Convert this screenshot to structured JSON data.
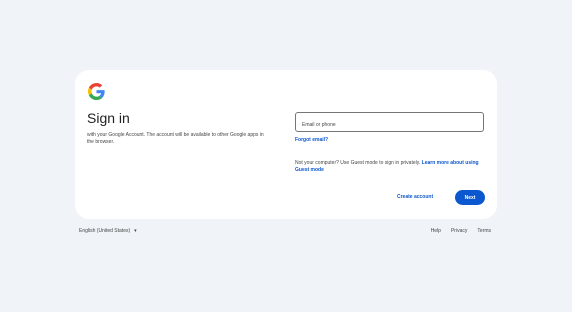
{
  "signin": {
    "title": "Sign in",
    "subtitle": "with your Google Account. The account will be available to other Google apps in the browser.",
    "email_placeholder": "Email or phone",
    "email_value": "",
    "forgot_email": "Forgot email?",
    "guest_text": "Not your computer? Use Guest mode to sign in privately.",
    "guest_link": "Learn more about using Guest mode",
    "create_account": "Create account",
    "next": "Next"
  },
  "footer": {
    "language": "English (United States)",
    "language_icon": "chevron-down-icon",
    "links": [
      "Help",
      "Privacy",
      "Terms"
    ]
  },
  "colors": {
    "background": "#f0f4f9",
    "card": "#ffffff",
    "primary": "#0b57d0",
    "text": "#1f1f1f",
    "muted": "#444746"
  },
  "icons": {
    "logo": "google-g-logo-icon"
  }
}
